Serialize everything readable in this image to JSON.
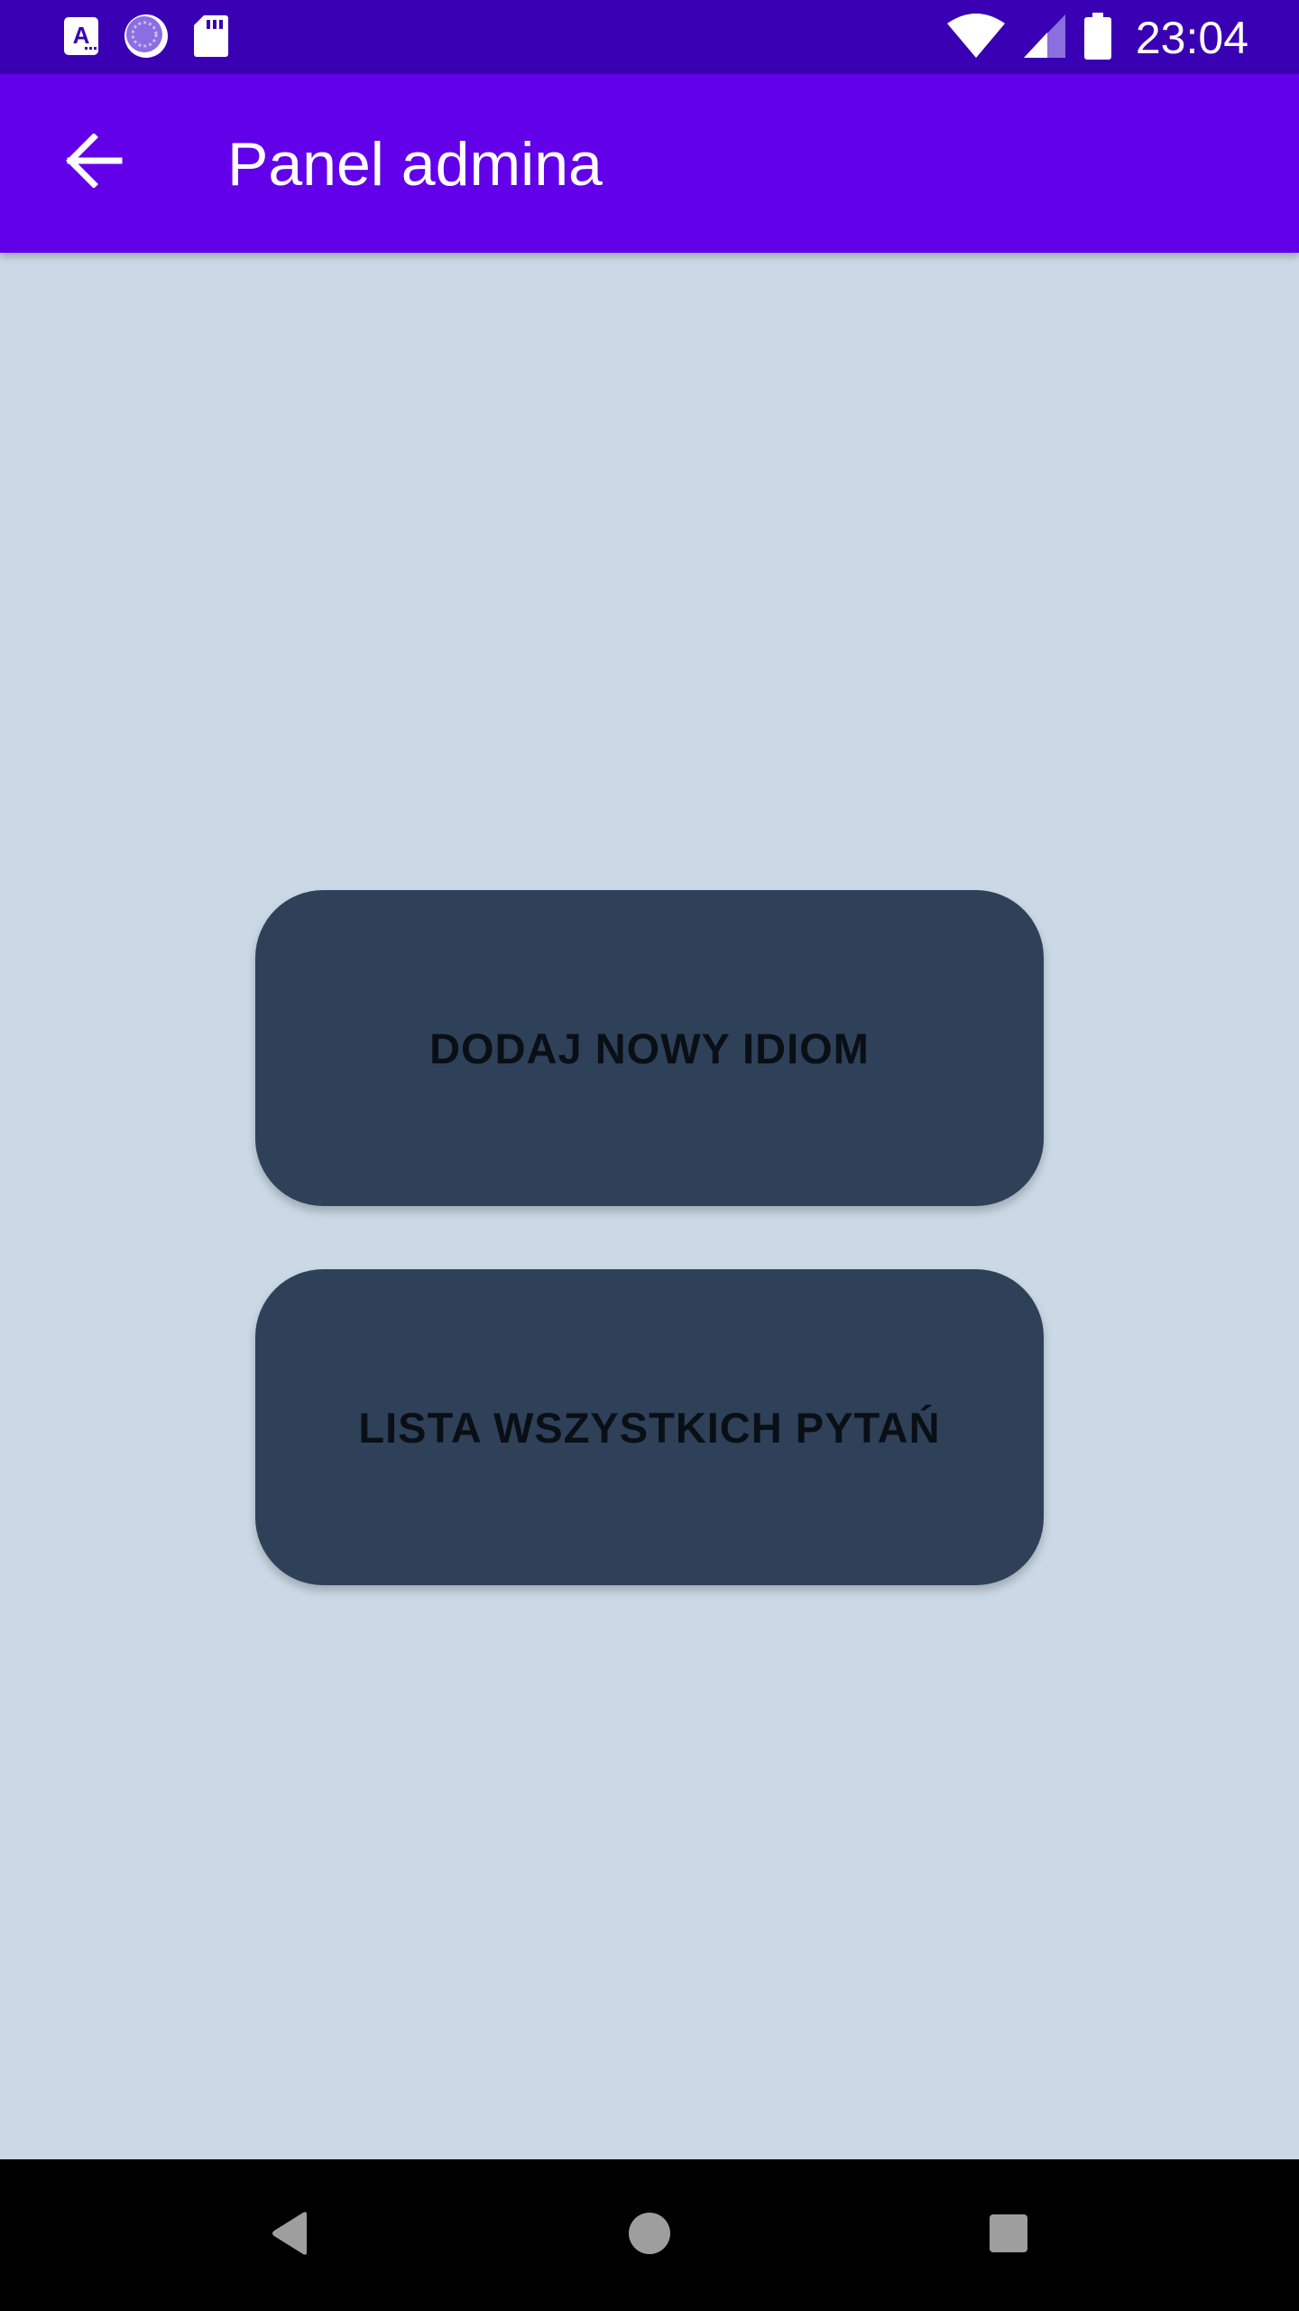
{
  "status_bar": {
    "time": "23:04",
    "icons": [
      "app-a-icon",
      "sync-circle-icon",
      "sd-card-icon",
      "wifi-icon",
      "signal-icon",
      "battery-icon"
    ]
  },
  "toolbar": {
    "title": "Panel admina",
    "back_icon": "arrow-back-icon"
  },
  "main": {
    "buttons": [
      {
        "label": "DODAJ NOWY IDIOM"
      },
      {
        "label": "LISTA WSZYSTKICH PYTAŃ"
      }
    ]
  },
  "nav_bar": {
    "icons": [
      "nav-back-icon",
      "nav-home-icon",
      "nav-recents-icon"
    ]
  },
  "colors": {
    "status_bar": "#3a00b3",
    "toolbar": "#6200ea",
    "background": "#cbd9e6",
    "button": "#2e4159",
    "button_text": "#0a0f16",
    "nav_bar": "#000000"
  }
}
